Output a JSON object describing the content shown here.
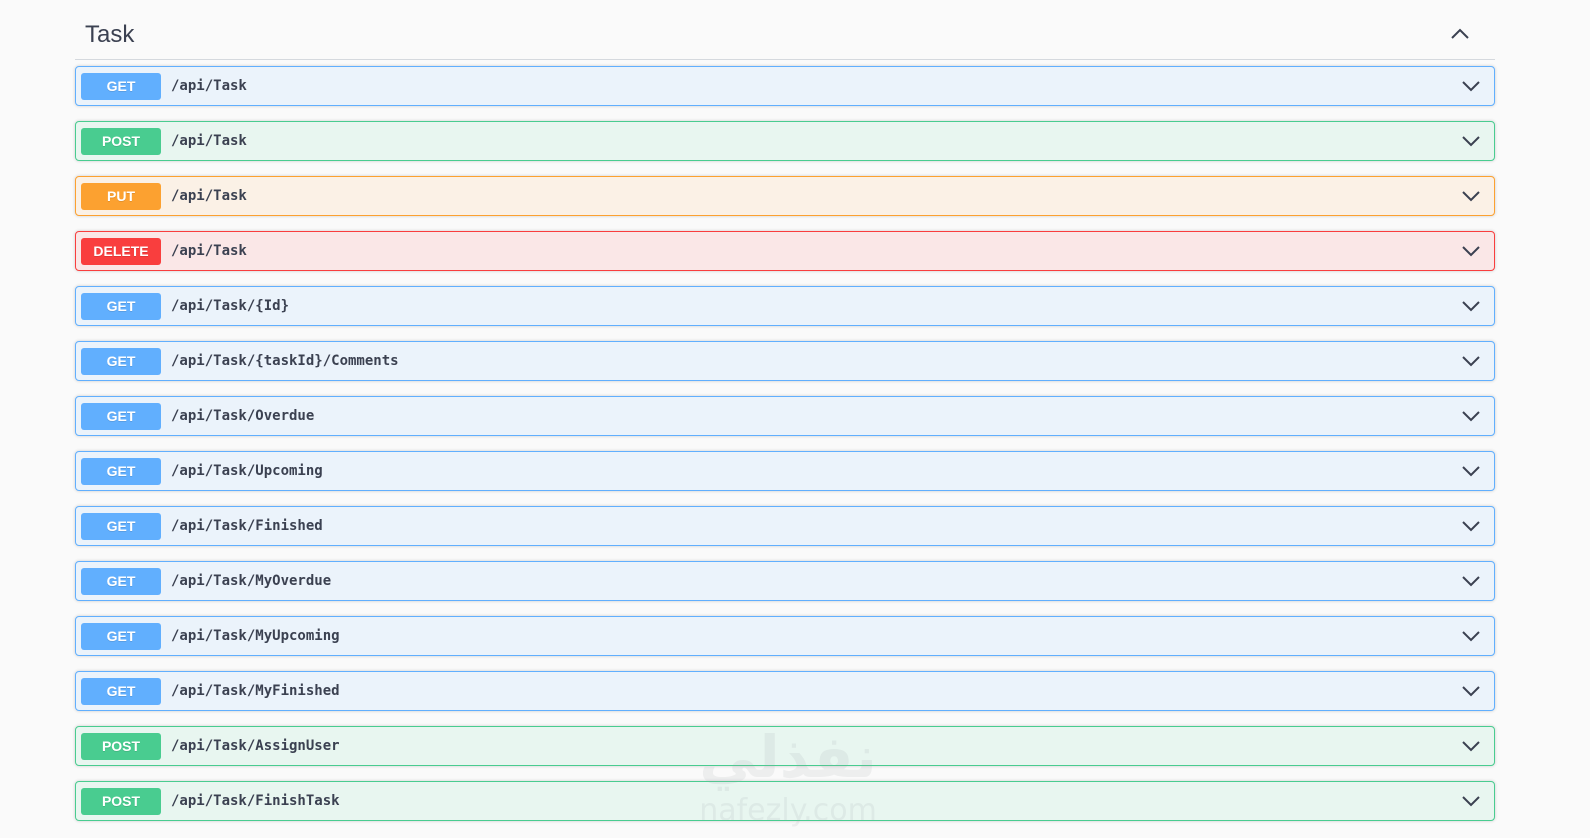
{
  "section": {
    "title": "Task",
    "collapse_icon": "chevron-up-icon"
  },
  "colors": {
    "get": "#61affe",
    "post": "#49cc90",
    "put": "#fca130",
    "delete": "#f93e3e",
    "text": "#3b4151"
  },
  "operations": [
    {
      "method": "GET",
      "path": "/api/Task"
    },
    {
      "method": "POST",
      "path": "/api/Task"
    },
    {
      "method": "PUT",
      "path": "/api/Task"
    },
    {
      "method": "DELETE",
      "path": "/api/Task"
    },
    {
      "method": "GET",
      "path": "/api/Task/{Id}"
    },
    {
      "method": "GET",
      "path": "/api/Task/{taskId}/Comments"
    },
    {
      "method": "GET",
      "path": "/api/Task/Overdue"
    },
    {
      "method": "GET",
      "path": "/api/Task/Upcoming"
    },
    {
      "method": "GET",
      "path": "/api/Task/Finished"
    },
    {
      "method": "GET",
      "path": "/api/Task/MyOverdue"
    },
    {
      "method": "GET",
      "path": "/api/Task/MyUpcoming"
    },
    {
      "method": "GET",
      "path": "/api/Task/MyFinished"
    },
    {
      "method": "POST",
      "path": "/api/Task/AssignUser"
    },
    {
      "method": "POST",
      "path": "/api/Task/FinishTask"
    }
  ],
  "watermark": {
    "arabic": "نفذلي",
    "latin": "nafezly.com"
  }
}
